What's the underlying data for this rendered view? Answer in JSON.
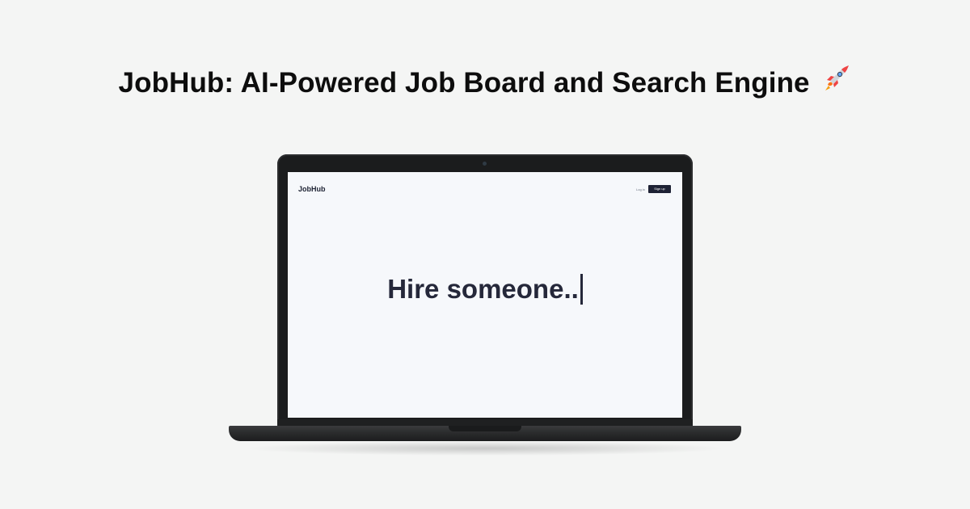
{
  "headline": {
    "title": "JobHub: AI-Powered Job Board and Search Engine",
    "emoji_icon": "rocket-icon"
  },
  "app": {
    "brand": "JobHub",
    "login_label": "Log in",
    "signup_label": "Sign up",
    "hero_text": "Hire someone.."
  },
  "colors": {
    "page_background": "#f4f5f4",
    "screen_background": "#f6f8fb",
    "text_dark": "#25283a",
    "button_dark": "#1e2235",
    "laptop_frame": "#1b1c1d"
  }
}
